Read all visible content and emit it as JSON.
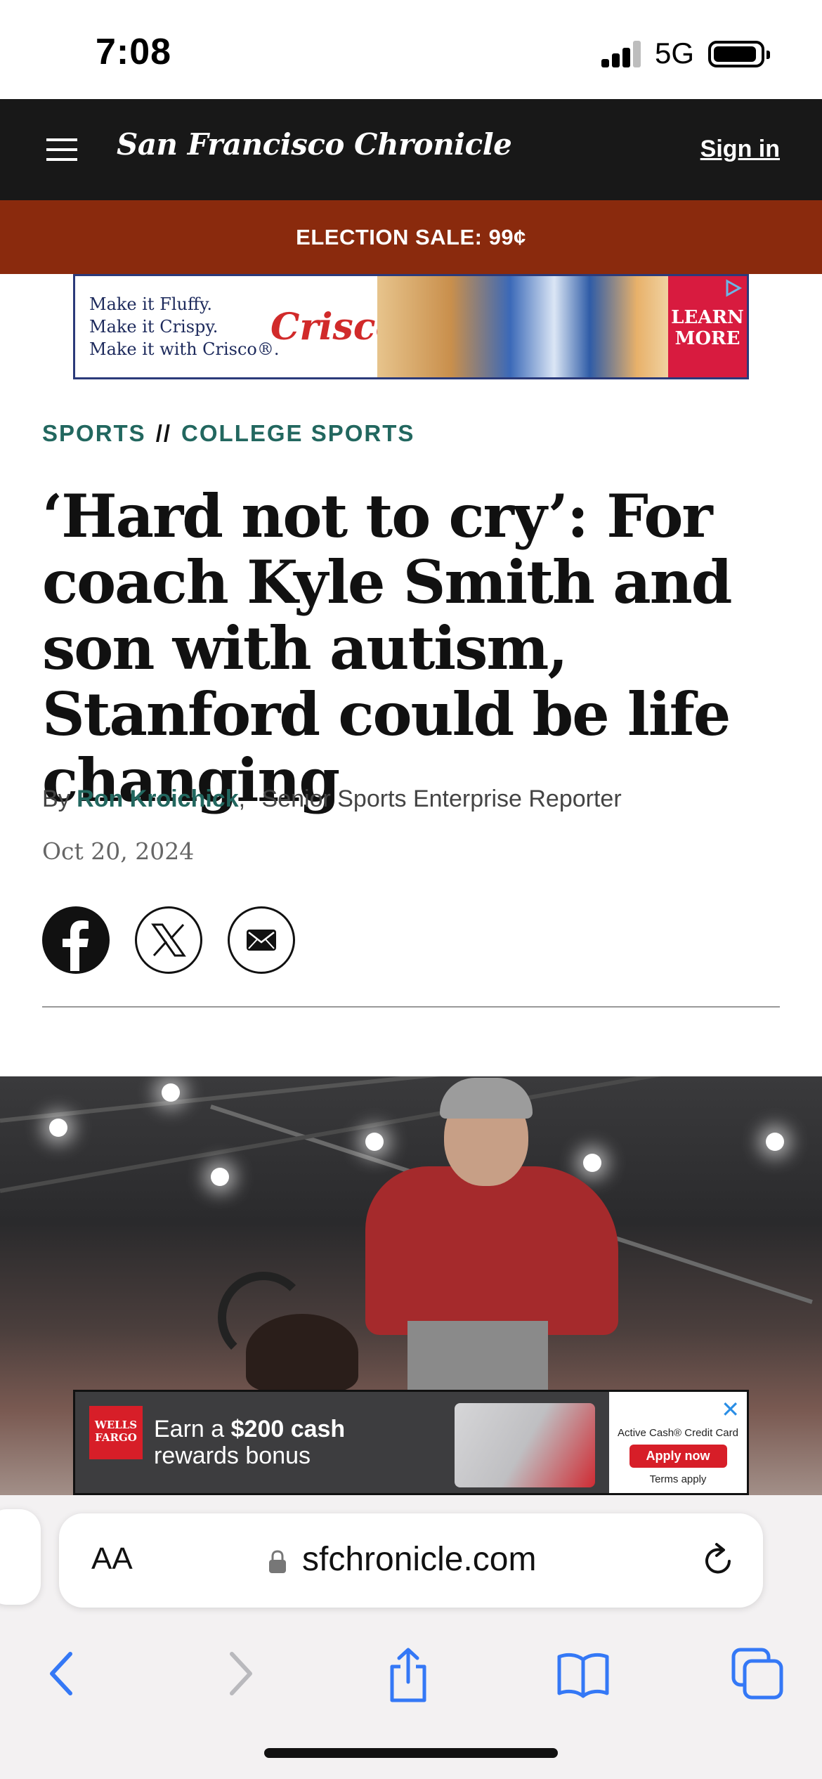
{
  "status_bar": {
    "time": "7:08",
    "network": "5G"
  },
  "nav": {
    "masthead": "San Francisco Chronicle",
    "sign_in": "Sign in"
  },
  "sale_banner": {
    "text": "ELECTION SALE: 99¢"
  },
  "ad_top": {
    "line1": "Make it Fluffy.",
    "line2": "Make it Crispy.",
    "line3": "Make it with Crisco®.",
    "brand": "Crisco",
    "cta_line1": "LEARN",
    "cta_line2": "MORE"
  },
  "article": {
    "section": "SPORTS",
    "separator": "//",
    "subsection": "COLLEGE SPORTS",
    "headline": "‘Hard not to cry’: For coach Kyle Smith and son with autism, Stanford could be life changing",
    "byline_prefix": "By",
    "author": "Ron Kroichick",
    "byline_comma": ",",
    "author_role": "Senior Sports Enterprise Reporter",
    "date": "Oct 20, 2024"
  },
  "share_icons": [
    "facebook-icon",
    "x-icon",
    "email-icon"
  ],
  "ad_bottom": {
    "logo_line1": "WELLS",
    "logo_line2": "FARGO",
    "text_pre": "Earn a ",
    "text_bold": "$200 cash",
    "text_line2": "rewards bonus",
    "right_title": "Active Cash® Credit Card",
    "apply": "Apply now",
    "terms": "Terms apply",
    "close": "✕"
  },
  "browser": {
    "text_size_label": "AA",
    "url": "sfchronicle.com"
  },
  "colors": {
    "nav_bg": "#181818",
    "sale_bg": "#8a2a0d",
    "accent_teal": "#22675f",
    "safari_blue": "#3478f6"
  }
}
